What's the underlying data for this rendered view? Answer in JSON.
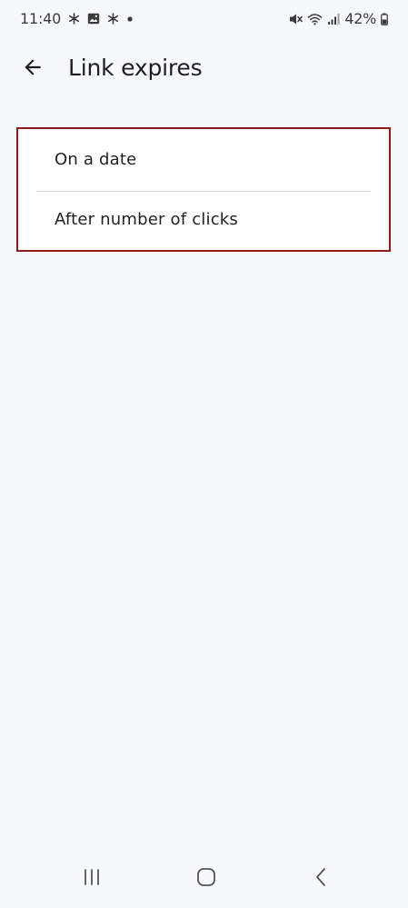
{
  "status_bar": {
    "time": "11:40",
    "battery_text": "42%",
    "left_icons": [
      "asterisk-icon",
      "gallery-icon",
      "asterisk-icon",
      "dot-icon"
    ],
    "right_icons": [
      "mute-icon",
      "wifi-icon",
      "signal-icon",
      "battery-icon"
    ]
  },
  "app_bar": {
    "title": "Link expires",
    "back_icon": "arrow-left-icon"
  },
  "options": [
    {
      "label": "On a date"
    },
    {
      "label": "After number of clicks"
    }
  ],
  "colors": {
    "background": "#f7f8fd",
    "card": "#ffffff",
    "highlight_border": "#8b1a1a",
    "text": "#222222"
  },
  "nav_bar": {
    "icons": [
      "recent-apps-icon",
      "home-icon",
      "back-nav-icon"
    ]
  }
}
